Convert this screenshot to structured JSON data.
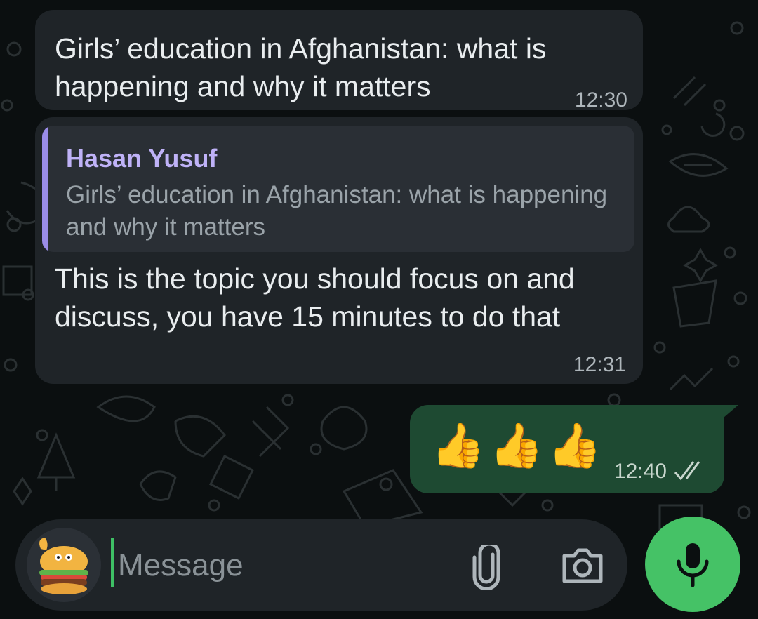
{
  "messages": [
    {
      "direction": "incoming",
      "text": "Girls’ education in Afghanistan: what is happening and why it matters",
      "time": "12:30"
    },
    {
      "direction": "incoming",
      "reply_to": {
        "author": "Hasan Yusuf",
        "text": "Girls’ education in Afghanistan: what is happening and why it matters"
      },
      "text": "This is the topic you should focus on and discuss, you have 15 minutes to do that",
      "time": "12:31"
    },
    {
      "direction": "outgoing",
      "text": "👍👍👍",
      "time": "12:40",
      "status_icon": "double-check-icon"
    }
  ],
  "composer": {
    "placeholder": "Message",
    "value": "",
    "sticker_icon": "burger-sticker-icon",
    "attach_icon": "paperclip-icon",
    "camera_icon": "camera-icon",
    "send_icon": "microphone-icon"
  },
  "colors": {
    "background": "#0b0f10",
    "incoming_bubble": "#1f2428",
    "outgoing_bubble": "#1e4a32",
    "reply_accent": "#9a8ce8",
    "mic_button": "#45c266"
  }
}
